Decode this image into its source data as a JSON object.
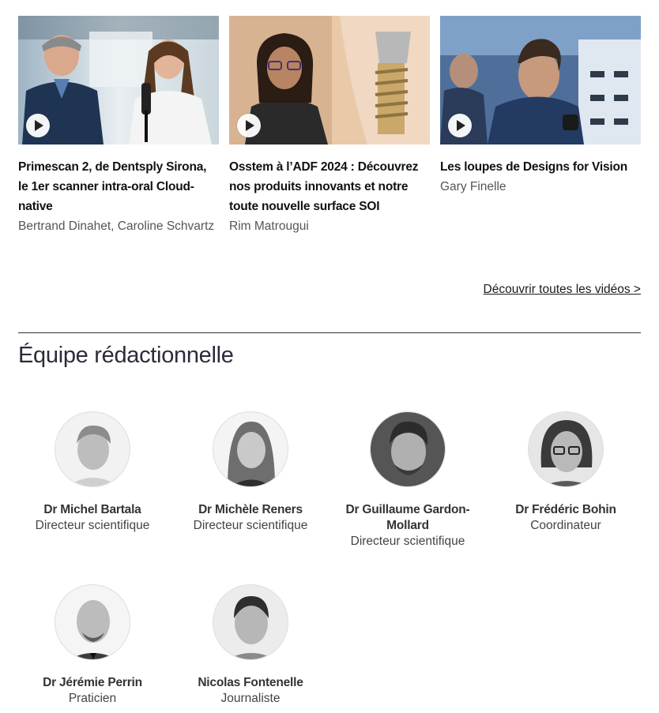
{
  "videos": [
    {
      "title": "Primescan 2, de Dentsply Sirona, le 1er scanner intra-oral Cloud-native",
      "author": "Bertrand Dinahet, Caroline Schvartz"
    },
    {
      "title": "Osstem à l’ADF 2024 : Découvrez nos produits innovants et notre toute nouvelle surface SOI",
      "author": "Rim Matrougui"
    },
    {
      "title": "Les loupes de Designs for Vision",
      "author": "Gary Finelle"
    }
  ],
  "all_videos_link": "Découvrir toutes les vidéos >",
  "team": {
    "title": "Équipe rédactionnelle",
    "members": [
      {
        "name": "Dr Michel Bartala",
        "role": "Directeur scientifique"
      },
      {
        "name": "Dr Michèle Reners",
        "role": "Directeur scientifique"
      },
      {
        "name": "Dr Guillaume Gardon-Mollard",
        "role": "Directeur scientifique"
      },
      {
        "name": "Dr Frédéric Bohin",
        "role": "Coordinateur"
      },
      {
        "name": "Dr Jérémie Perrin",
        "role": "Praticien"
      },
      {
        "name": "Nicolas Fontenelle",
        "role": "Journaliste"
      }
    ]
  }
}
